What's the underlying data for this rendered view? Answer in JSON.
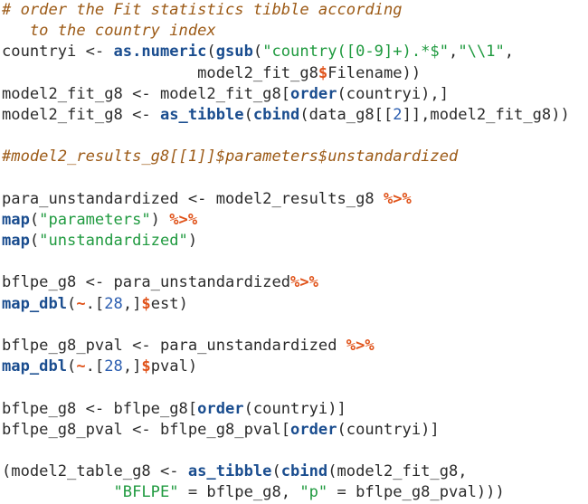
{
  "editor": {
    "language": "R",
    "background_color": "#ffffff",
    "font_size_px": 17,
    "line_height_px": 23
  },
  "theme": {
    "plain_text": "#2b2b2b",
    "comment": "#9c5a16",
    "function_name": "#1a4d8f",
    "string": "#1f9a3f",
    "operator": "#e0531a",
    "number": "#2a5db0"
  },
  "code": {
    "lines": [
      {
        "id": "line-1",
        "tokens": [
          {
            "t": "comment",
            "s": "# order the Fit statistics tibble according"
          }
        ]
      },
      {
        "id": "line-2",
        "tokens": [
          {
            "t": "comment",
            "s": "   to the country index"
          }
        ]
      },
      {
        "id": "line-3",
        "tokens": [
          {
            "t": "plain",
            "s": "countryi <- "
          },
          {
            "t": "func",
            "s": "as.numeric"
          },
          {
            "t": "plain",
            "s": "("
          },
          {
            "t": "func",
            "s": "gsub"
          },
          {
            "t": "plain",
            "s": "("
          },
          {
            "t": "string",
            "s": "\"country([0-9]+).*$\""
          },
          {
            "t": "plain",
            "s": ","
          },
          {
            "t": "string",
            "s": "\"\\\\1\""
          },
          {
            "t": "plain",
            "s": ","
          }
        ]
      },
      {
        "id": "line-4",
        "tokens": [
          {
            "t": "plain",
            "s": "                     model2_fit_g8"
          },
          {
            "t": "op",
            "s": "$"
          },
          {
            "t": "plain",
            "s": "Filename))"
          }
        ]
      },
      {
        "id": "line-5",
        "tokens": [
          {
            "t": "plain",
            "s": "model2_fit_g8 <- model2_fit_g8["
          },
          {
            "t": "func",
            "s": "order"
          },
          {
            "t": "plain",
            "s": "(countryi),]"
          }
        ]
      },
      {
        "id": "line-6",
        "tokens": [
          {
            "t": "plain",
            "s": "model2_fit_g8 <- "
          },
          {
            "t": "func",
            "s": "as_tibble"
          },
          {
            "t": "plain",
            "s": "("
          },
          {
            "t": "func",
            "s": "cbind"
          },
          {
            "t": "plain",
            "s": "(data_g8[["
          },
          {
            "t": "number",
            "s": "2"
          },
          {
            "t": "plain",
            "s": "]],model2_fit_g8))"
          }
        ]
      },
      {
        "id": "line-7",
        "tokens": []
      },
      {
        "id": "line-8",
        "tokens": [
          {
            "t": "comment",
            "s": "#model2_results_g8[[1]]$parameters$unstandardized"
          }
        ]
      },
      {
        "id": "line-9",
        "tokens": []
      },
      {
        "id": "line-10",
        "tokens": [
          {
            "t": "plain",
            "s": "para_unstandardized <- model2_results_g8 "
          },
          {
            "t": "op",
            "s": "%>%"
          }
        ]
      },
      {
        "id": "line-11",
        "tokens": [
          {
            "t": "func",
            "s": "map"
          },
          {
            "t": "plain",
            "s": "("
          },
          {
            "t": "string",
            "s": "\"parameters\""
          },
          {
            "t": "plain",
            "s": ") "
          },
          {
            "t": "op",
            "s": "%>%"
          }
        ]
      },
      {
        "id": "line-12",
        "tokens": [
          {
            "t": "func",
            "s": "map"
          },
          {
            "t": "plain",
            "s": "("
          },
          {
            "t": "string",
            "s": "\"unstandardized\""
          },
          {
            "t": "plain",
            "s": ")"
          }
        ]
      },
      {
        "id": "line-13",
        "tokens": []
      },
      {
        "id": "line-14",
        "tokens": [
          {
            "t": "plain",
            "s": "bflpe_g8 <- para_unstandardized"
          },
          {
            "t": "op",
            "s": "%>%"
          }
        ]
      },
      {
        "id": "line-15",
        "tokens": [
          {
            "t": "func",
            "s": "map_dbl"
          },
          {
            "t": "plain",
            "s": "("
          },
          {
            "t": "op",
            "s": "~"
          },
          {
            "t": "plain",
            "s": ".["
          },
          {
            "t": "number",
            "s": "28"
          },
          {
            "t": "plain",
            "s": ",]"
          },
          {
            "t": "op",
            "s": "$"
          },
          {
            "t": "plain",
            "s": "est)"
          }
        ]
      },
      {
        "id": "line-16",
        "tokens": []
      },
      {
        "id": "line-17",
        "tokens": [
          {
            "t": "plain",
            "s": "bflpe_g8_pval <- para_unstandardized "
          },
          {
            "t": "op",
            "s": "%>%"
          }
        ]
      },
      {
        "id": "line-18",
        "tokens": [
          {
            "t": "func",
            "s": "map_dbl"
          },
          {
            "t": "plain",
            "s": "("
          },
          {
            "t": "op",
            "s": "~"
          },
          {
            "t": "plain",
            "s": ".["
          },
          {
            "t": "number",
            "s": "28"
          },
          {
            "t": "plain",
            "s": ",]"
          },
          {
            "t": "op",
            "s": "$"
          },
          {
            "t": "plain",
            "s": "pval)"
          }
        ]
      },
      {
        "id": "line-19",
        "tokens": []
      },
      {
        "id": "line-20",
        "tokens": [
          {
            "t": "plain",
            "s": "bflpe_g8 <- bflpe_g8["
          },
          {
            "t": "func",
            "s": "order"
          },
          {
            "t": "plain",
            "s": "(countryi)]"
          }
        ]
      },
      {
        "id": "line-21",
        "tokens": [
          {
            "t": "plain",
            "s": "bflpe_g8_pval <- bflpe_g8_pval["
          },
          {
            "t": "func",
            "s": "order"
          },
          {
            "t": "plain",
            "s": "(countryi)]"
          }
        ]
      },
      {
        "id": "line-22",
        "tokens": []
      },
      {
        "id": "line-23",
        "tokens": [
          {
            "t": "plain",
            "s": "(model2_table_g8 <- "
          },
          {
            "t": "func",
            "s": "as_tibble"
          },
          {
            "t": "plain",
            "s": "("
          },
          {
            "t": "func",
            "s": "cbind"
          },
          {
            "t": "plain",
            "s": "(model2_fit_g8,"
          }
        ]
      },
      {
        "id": "line-24",
        "tokens": [
          {
            "t": "plain",
            "s": "            "
          },
          {
            "t": "string",
            "s": "\"BFLPE\""
          },
          {
            "t": "plain",
            "s": " = bflpe_g8, "
          },
          {
            "t": "string",
            "s": "\"p\""
          },
          {
            "t": "plain",
            "s": " = bflpe_g8_pval)))"
          }
        ]
      }
    ]
  }
}
